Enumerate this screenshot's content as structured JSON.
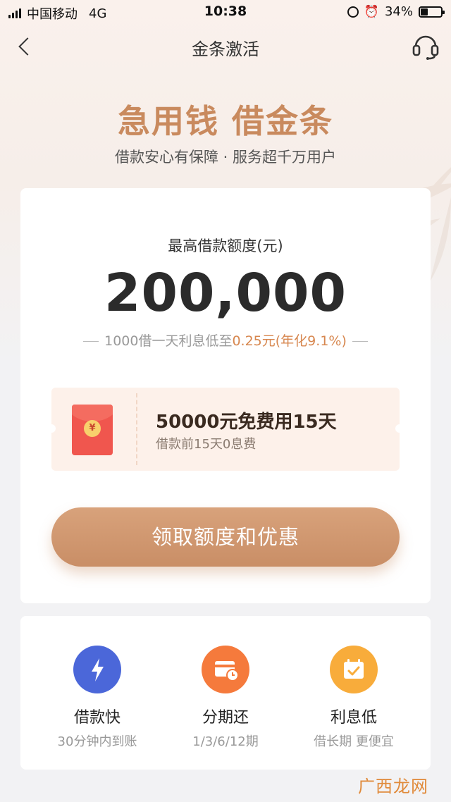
{
  "status_bar": {
    "carrier": "中国移动",
    "network": "4G",
    "time": "10:38",
    "battery_percent": "34%",
    "battery_level": 0.34
  },
  "nav": {
    "title": "金条激活",
    "back_icon": "back-arrow-icon",
    "support_icon": "headset-icon"
  },
  "hero": {
    "title": "急用钱 借金条",
    "subtitle": "借款安心有保障 · 服务超千万用户"
  },
  "limit": {
    "label": "最高借款额度(元)",
    "value": "200,000",
    "interest_prefix": "1000借一天利息低至",
    "interest_highlight": "0.25元(年化9.1%)"
  },
  "coupon": {
    "icon": "red-packet-icon",
    "coin_symbol": "¥",
    "title": "50000元免费用15天",
    "subtitle": "借款前15天0息费"
  },
  "claim_button": {
    "label": "领取额度和优惠"
  },
  "features": [
    {
      "icon": "lightning-icon",
      "color": "#4b67d9",
      "name": "借款快",
      "desc": "30分钟内到账"
    },
    {
      "icon": "card-clock-icon",
      "color": "#f57a3c",
      "name": "分期还",
      "desc": "1/3/6/12期"
    },
    {
      "icon": "calendar-check-icon",
      "color": "#f8ac3b",
      "name": "利息低",
      "desc": "借长期 更便宜"
    }
  ],
  "colors": {
    "accent": "#c98e66",
    "hero_title": "#c98a5e",
    "highlight": "#d7874f"
  },
  "watermark": "广西龙网"
}
